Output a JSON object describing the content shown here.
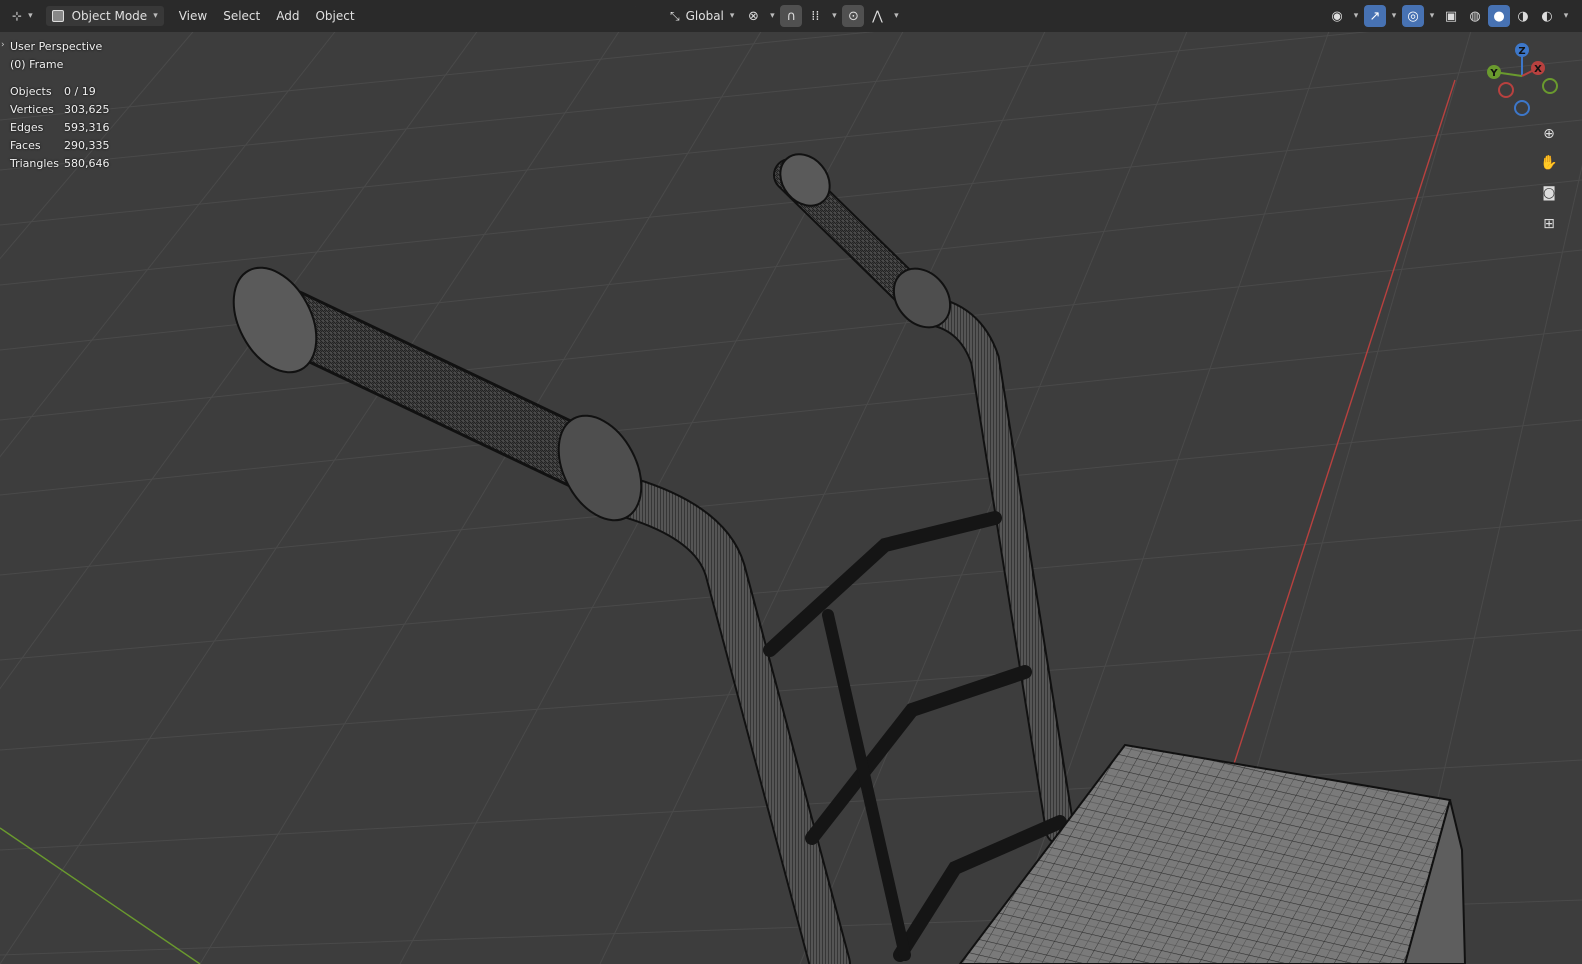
{
  "header": {
    "editor_icon": "editor-type-icon",
    "mode": {
      "label": "Object Mode",
      "icon": "object-mode-icon"
    },
    "menus": [
      "View",
      "Select",
      "Add",
      "Object"
    ],
    "transform_orientation": "Global",
    "icons_center": [
      "transform-pivot-icon",
      "snap-icon",
      "snap-target-icon",
      "proportional-editing-icon",
      "falloff-icon"
    ],
    "icons_right": [
      "visibility-icon",
      "gizmo-icon",
      "overlay-icon",
      "xray-icon",
      "wireframe-shading-icon",
      "solid-shading-icon",
      "material-shading-icon",
      "rendered-shading-icon"
    ]
  },
  "overlay": {
    "view_name": "User Perspective",
    "frame_label": "(0) Frame"
  },
  "stats": [
    {
      "label": "Objects",
      "value": "0 / 19"
    },
    {
      "label": "Vertices",
      "value": "303,625"
    },
    {
      "label": "Edges",
      "value": "593,316"
    },
    {
      "label": "Faces",
      "value": "290,335"
    },
    {
      "label": "Triangles",
      "value": "580,646"
    }
  ],
  "gizmo": {
    "z_label": "Z",
    "y_label": "Y",
    "x_label": "X"
  },
  "nav_buttons": [
    "zoom-icon",
    "pan-hand-icon",
    "camera-icon",
    "orthographic-grid-icon"
  ],
  "colors": {
    "accent": "#4772b3",
    "x_axis": "#b8413f",
    "y_axis": "#6a9a2e",
    "z_axis": "#3d77c9",
    "viewport_bg": "#3d3d3d",
    "wire": "#111111"
  }
}
